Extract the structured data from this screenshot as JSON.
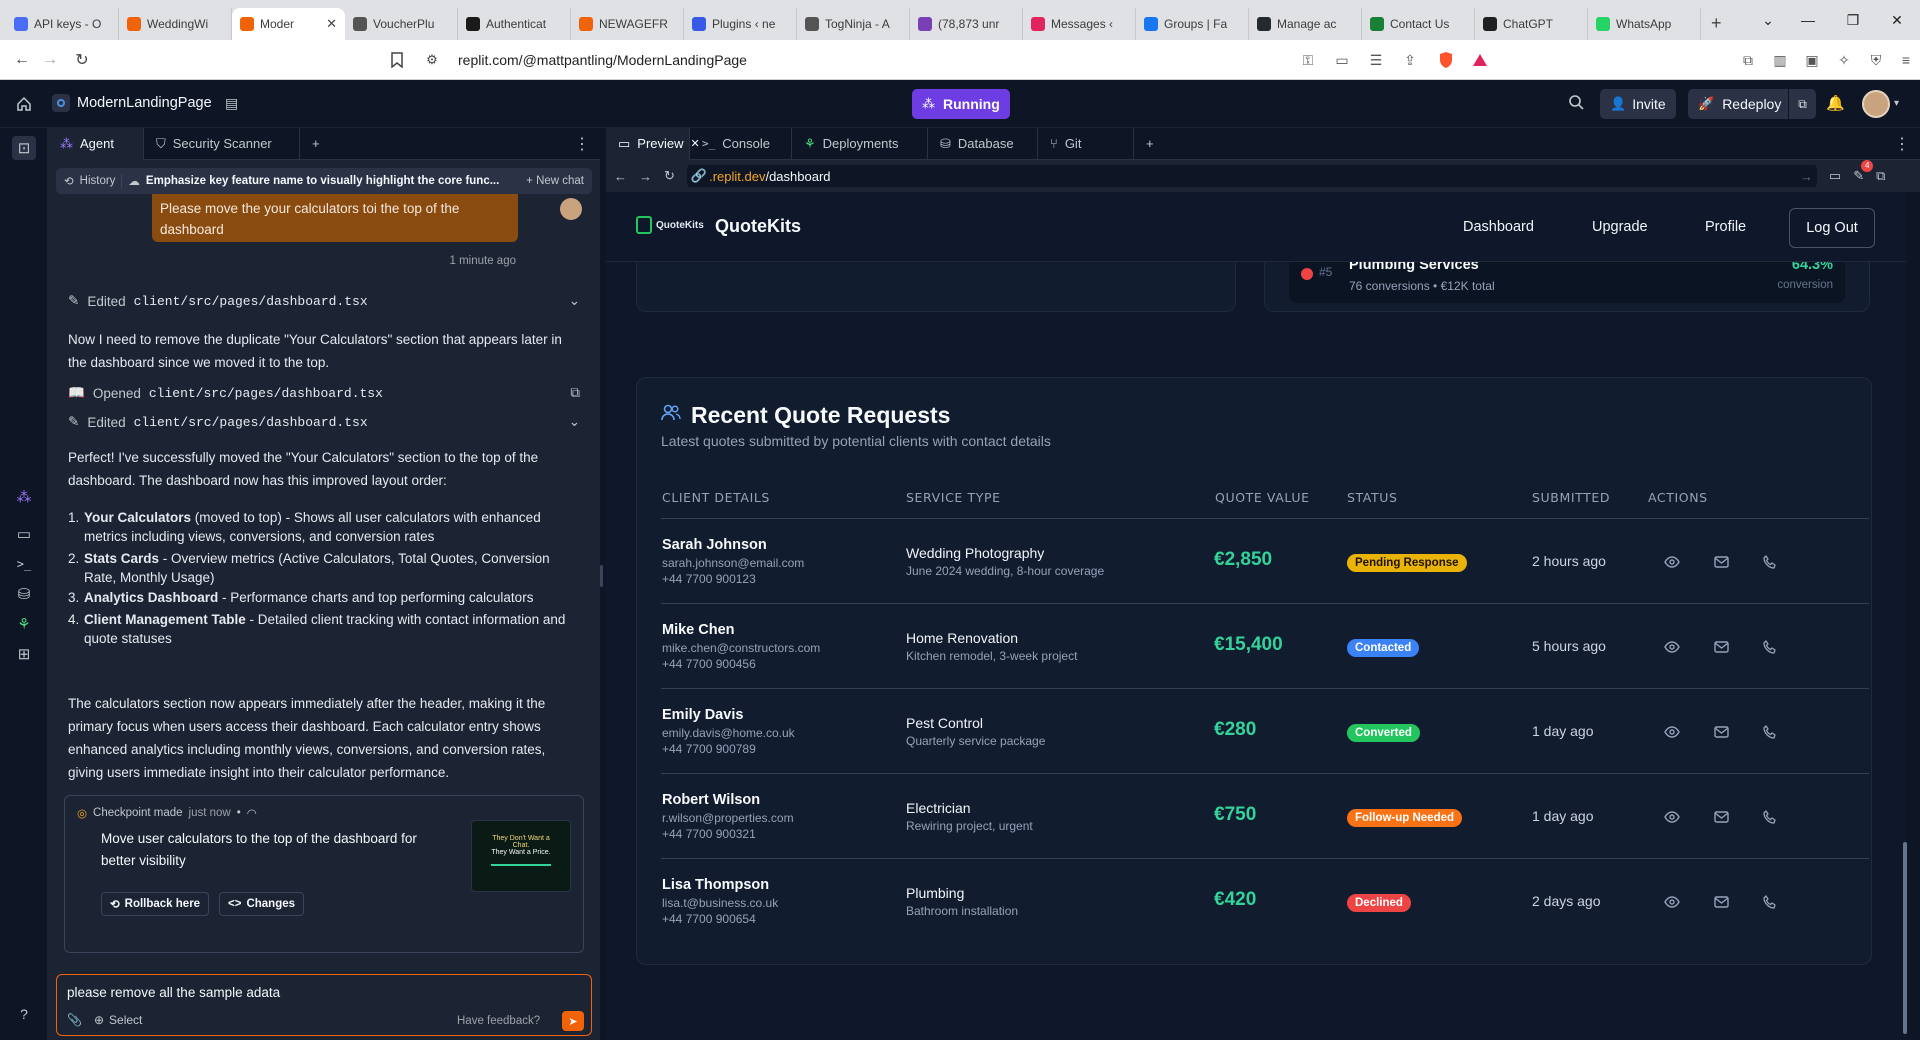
{
  "browser": {
    "tabs": [
      {
        "label": "API keys - O",
        "icon": "openai-icon",
        "color": "#4a6cf7"
      },
      {
        "label": "WeddingWi",
        "icon": "replit-icon",
        "color": "#f26207"
      },
      {
        "label": "Moder",
        "icon": "replit-icon",
        "color": "#f26207",
        "active": true
      },
      {
        "label": "VoucherPlu",
        "icon": "globe-icon",
        "color": "#555555"
      },
      {
        "label": "Authenticat",
        "icon": "auth-icon",
        "color": "#1a1a1a"
      },
      {
        "label": "NEWAGEFR",
        "icon": "replit-icon",
        "color": "#f26207"
      },
      {
        "label": "Plugins ‹ ne",
        "icon": "wordpress-icon",
        "color": "#3858e9"
      },
      {
        "label": "TogNinja - A",
        "icon": "globe-icon",
        "color": "#555555"
      },
      {
        "label": "(78,873 unr",
        "icon": "mail-icon",
        "color": "#7b3fb5"
      },
      {
        "label": "Messages ‹",
        "icon": "messages-icon",
        "color": "#e0245e"
      },
      {
        "label": "Groups | Fa",
        "icon": "facebook-icon",
        "color": "#1877f2"
      },
      {
        "label": "Manage ac",
        "icon": "github-icon",
        "color": "#24292f"
      },
      {
        "label": "Contact Us",
        "icon": "w-icon",
        "color": "#1a7f37"
      },
      {
        "label": "ChatGPT",
        "icon": "chatgpt-icon",
        "color": "#202123"
      },
      {
        "label": "WhatsApp",
        "icon": "whatsapp-icon",
        "color": "#25d366"
      }
    ],
    "url": "replit.com/@mattpantling/ModernLandingPage"
  },
  "replit": {
    "project_name": "ModernLandingPage",
    "run_status": "Running",
    "invite_label": "Invite",
    "redeploy_label": "Redeploy"
  },
  "agent_panel": {
    "tabs": [
      "Agent",
      "Security Scanner"
    ],
    "history_label": "History",
    "chat_title": "Emphasize key feature name to visually highlight the core func...",
    "new_chat_label": "New chat",
    "user_message": "Please move the your calculators toi the top of the dashboard",
    "user_message_time": "1 minute ago",
    "op1_verb": "Edited",
    "op1_file": "client/src/pages/dashboard.tsx",
    "para1": "Now I need to remove the duplicate \"Your Calculators\" section that appears later in the dashboard since we moved it to the top.",
    "op2_verb": "Opened",
    "op2_file": "client/src/pages/dashboard.tsx",
    "op3_verb": "Edited",
    "op3_file": "client/src/pages/dashboard.tsx",
    "para2": "Perfect! I've successfully moved the \"Your Calculators\" section to the top of the dashboard. The dashboard now has this improved layout order:",
    "list": [
      {
        "num": "1.",
        "bold": "Your Calculators",
        "rest": " (moved to top) - Shows all user calculators with enhanced metrics including views, conversions, and conversion rates"
      },
      {
        "num": "2.",
        "bold": "Stats Cards",
        "rest": " - Overview metrics (Active Calculators, Total Quotes, Conversion Rate, Monthly Usage)"
      },
      {
        "num": "3.",
        "bold": "Analytics Dashboard",
        "rest": " - Performance charts and top performing calculators"
      },
      {
        "num": "4.",
        "bold": "Client Management Table",
        "rest": " - Detailed client tracking with contact information and quote statuses"
      }
    ],
    "para3": "The calculators section now appears immediately after the header, making it the primary focus when users access their dashboard. Each calculator entry shows enhanced analytics including monthly views, conversions, and conversion rates, giving users immediate insight into their calculator performance.",
    "checkpoint_label": "Checkpoint made",
    "checkpoint_time": "just now",
    "checkpoint_text": "Move user calculators to the top of the dashboard for better visibility",
    "thumb_line1": "They Don't Want a",
    "thumb_line2": "Chat.",
    "thumb_line3": "They Want a Price.",
    "rollback_label": "Rollback here",
    "changes_label": "Changes",
    "input_value": "please remove all the sample adata",
    "select_label": "Select",
    "feedback_label": "Have feedback?"
  },
  "preview_panel": {
    "tabs": [
      "Preview",
      "Console",
      "Deployments",
      "Database",
      "Git"
    ],
    "url_prefix": ".replit.dev",
    "url_path": "/dashboard",
    "notification_count": "4"
  },
  "site": {
    "logo_text": "QuoteKits",
    "brand": "QuoteKits",
    "nav": [
      "Dashboard",
      "Upgrade",
      "Profile"
    ],
    "logout_label": "Log Out",
    "top_item": {
      "rank": "#5",
      "name": "Plumbing Services",
      "meta": "76 conversions • €12K total",
      "rate": "64.3%",
      "rate_label": "conversion"
    },
    "section_title": "Recent Quote Requests",
    "section_subtitle": "Latest quotes submitted by potential clients with contact details",
    "columns": [
      "CLIENT DETAILS",
      "SERVICE TYPE",
      "QUOTE VALUE",
      "STATUS",
      "SUBMITTED",
      "ACTIONS"
    ],
    "rows": [
      {
        "name": "Sarah Johnson",
        "email": "sarah.johnson@email.com",
        "phone": "+44 7700 900123",
        "service": "Wedding Photography",
        "detail": "June 2024 wedding, 8-hour coverage",
        "value": "€2,850",
        "status": "Pending Response",
        "status_color": "#eab308",
        "status_text": "#1f1300",
        "submitted": "2 hours ago"
      },
      {
        "name": "Mike Chen",
        "email": "mike.chen@constructors.com",
        "phone": "+44 7700 900456",
        "service": "Home Renovation",
        "detail": "Kitchen remodel, 3-week project",
        "value": "€15,400",
        "status": "Contacted",
        "status_color": "#3b82f6",
        "status_text": "#ffffff",
        "submitted": "5 hours ago"
      },
      {
        "name": "Emily Davis",
        "email": "emily.davis@home.co.uk",
        "phone": "+44 7700 900789",
        "service": "Pest Control",
        "detail": "Quarterly service package",
        "value": "€280",
        "status": "Converted",
        "status_color": "#22c55e",
        "status_text": "#ffffff",
        "submitted": "1 day ago"
      },
      {
        "name": "Robert Wilson",
        "email": "r.wilson@properties.com",
        "phone": "+44 7700 900321",
        "service": "Electrician",
        "detail": "Rewiring project, urgent",
        "value": "€750",
        "status": "Follow-up Needed",
        "status_color": "#f97316",
        "status_text": "#ffffff",
        "submitted": "1 day ago"
      },
      {
        "name": "Lisa Thompson",
        "email": "lisa.t@business.co.uk",
        "phone": "+44 7700 900654",
        "service": "Plumbing",
        "detail": "Bathroom installation",
        "value": "€420",
        "status": "Declined",
        "status_color": "#ef4444",
        "status_text": "#ffffff",
        "submitted": "2 days ago"
      }
    ]
  }
}
